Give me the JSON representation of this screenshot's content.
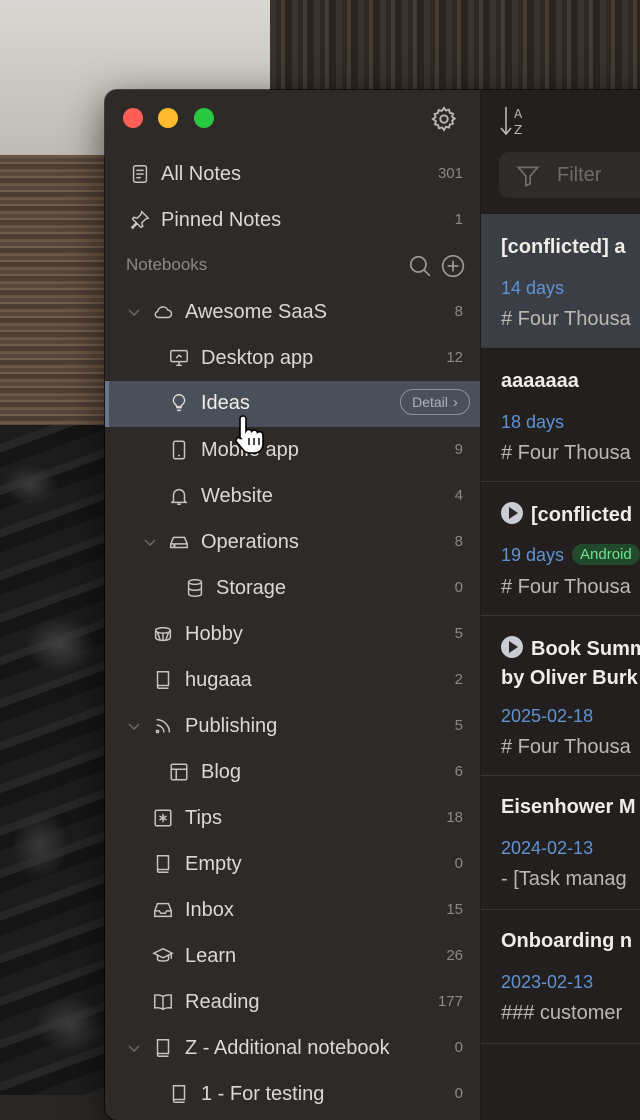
{
  "sidebar": {
    "all_notes": {
      "label": "All Notes",
      "count": "301"
    },
    "pinned_notes": {
      "label": "Pinned Notes",
      "count": "1"
    },
    "section_label": "Notebooks",
    "notebooks": [
      {
        "label": "Awesome SaaS",
        "count": "8",
        "icon": "cloud-icon"
      },
      {
        "label": "Desktop app",
        "count": "12",
        "icon": "desktop-icon"
      },
      {
        "label": "Ideas",
        "count": "",
        "icon": "lightbulb-icon",
        "detail": "Detail"
      },
      {
        "label": "Mobile app",
        "count": "9",
        "icon": "phone-icon"
      },
      {
        "label": "Website",
        "count": "4",
        "icon": "bell-icon"
      },
      {
        "label": "Operations",
        "count": "8",
        "icon": "drive-icon"
      },
      {
        "label": "Storage",
        "count": "0",
        "icon": "database-icon"
      },
      {
        "label": "Hobby",
        "count": "5",
        "icon": "drum-icon"
      },
      {
        "label": "hugaaa",
        "count": "2",
        "icon": "book-icon"
      },
      {
        "label": "Publishing",
        "count": "5",
        "icon": "rss-icon"
      },
      {
        "label": "Blog",
        "count": "6",
        "icon": "layout-icon"
      },
      {
        "label": "Tips",
        "count": "18",
        "icon": "asterisk-icon"
      },
      {
        "label": "Empty",
        "count": "0",
        "icon": "book-icon"
      },
      {
        "label": "Inbox",
        "count": "15",
        "icon": "inbox-icon"
      },
      {
        "label": "Learn",
        "count": "26",
        "icon": "graduation-cap-icon"
      },
      {
        "label": "Reading",
        "count": "177",
        "icon": "open-book-icon"
      },
      {
        "label": "Z - Additional notebook",
        "count": "0",
        "icon": "book-icon"
      },
      {
        "label": "1 - For testing",
        "count": "0",
        "icon": "book-icon"
      }
    ]
  },
  "notes_list": {
    "filter_placeholder": "Filter",
    "notes": [
      {
        "title": "[conflicted] a",
        "date": "14 days",
        "snippet": "# Four Thousa"
      },
      {
        "title": "aaaaaaa",
        "date": "18 days",
        "snippet": "# Four Thousa"
      },
      {
        "title": "[conflicted",
        "date": "19 days",
        "badge": "Android",
        "snippet": "# Four Thousa"
      },
      {
        "title": "Book Summ",
        "title2": "by Oliver Burk",
        "date": "2025-02-18",
        "snippet": "# Four Thousa"
      },
      {
        "title": "Eisenhower M",
        "date": "2024-02-13",
        "snippet": "- [Task manag"
      },
      {
        "title": "Onboarding n",
        "date": "2023-02-13",
        "snippet": "### customer"
      }
    ]
  },
  "colors": {
    "accent": "#5f93d3",
    "selected": "#49505a",
    "badge_text": "#6fe08b"
  }
}
